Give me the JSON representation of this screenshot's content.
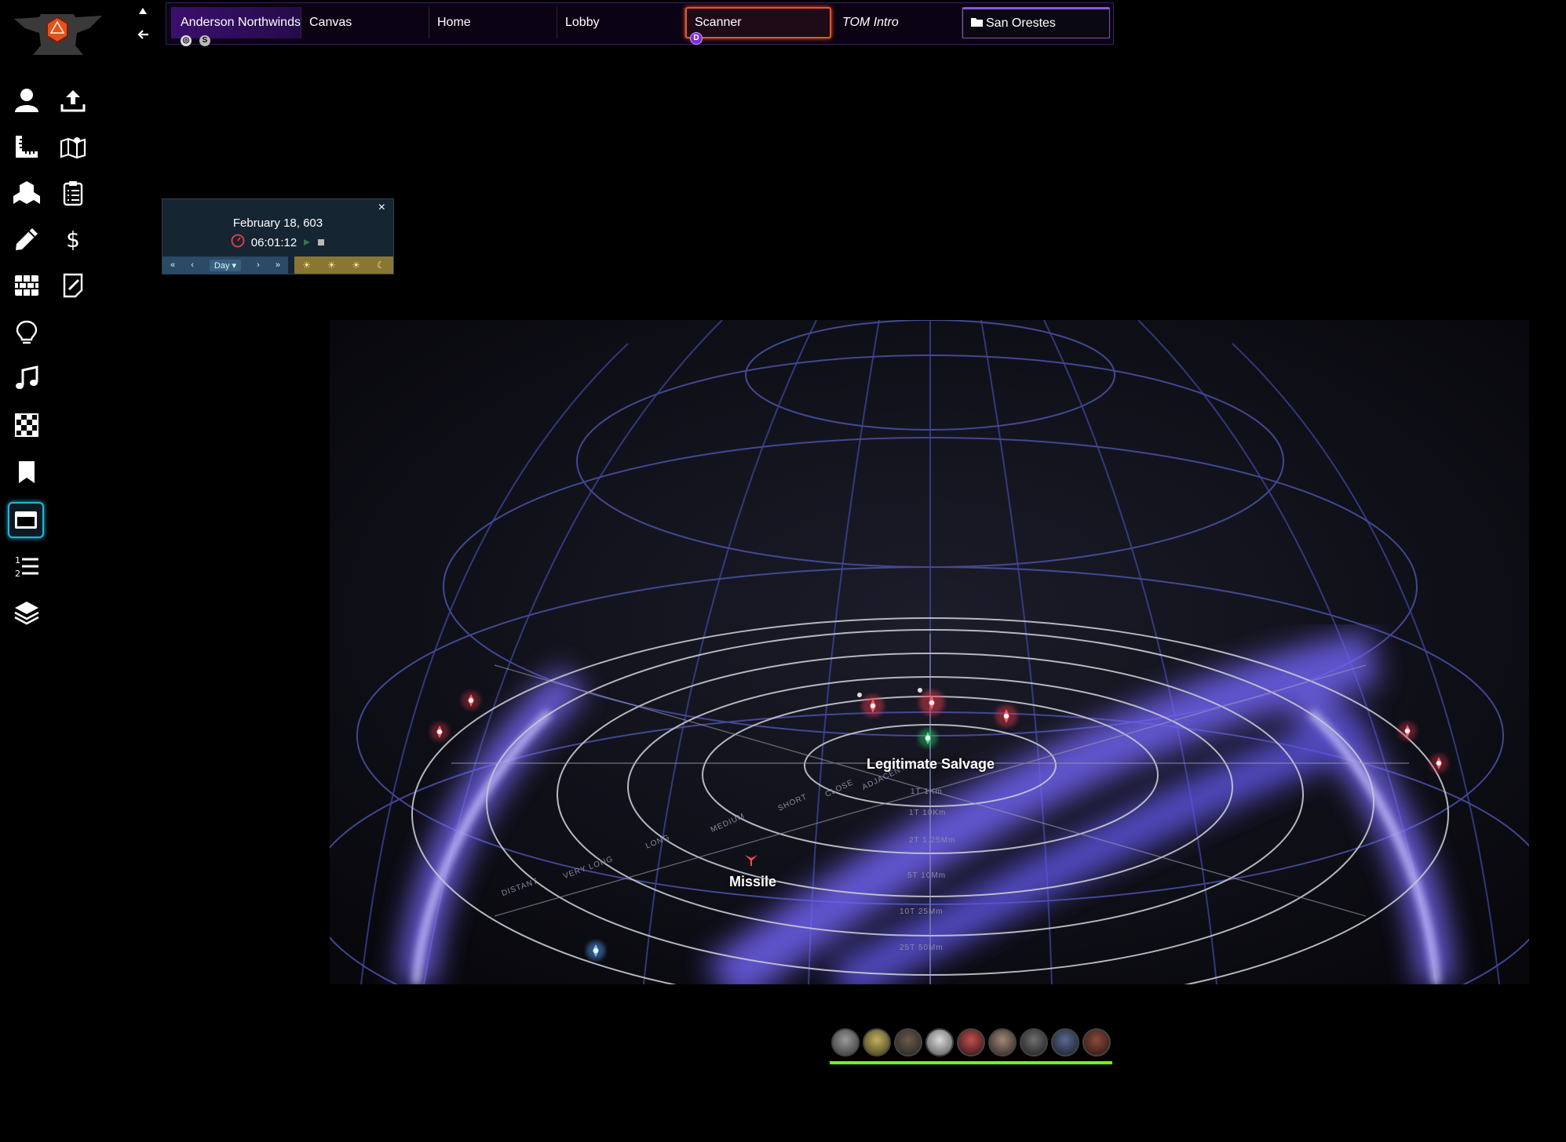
{
  "app": {
    "navigation": {
      "up_icon": "triangle-up-icon",
      "back_icon": "arrow-left-icon"
    },
    "sidebar": {
      "tools": [
        {
          "name": "character",
          "icon": "person-icon"
        },
        {
          "name": "upload",
          "icon": "upload-icon"
        },
        {
          "name": "measure",
          "icon": "ruler-icon"
        },
        {
          "name": "maps",
          "icon": "map-icon"
        },
        {
          "name": "items",
          "icon": "cubes-icon"
        },
        {
          "name": "journal",
          "icon": "clipboard-icon"
        },
        {
          "name": "draw",
          "icon": "pencil-icon"
        },
        {
          "name": "currency",
          "icon": "dollar-icon"
        },
        {
          "name": "walls",
          "icon": "bricks-icon"
        },
        {
          "name": "notes",
          "icon": "note-edit-icon"
        },
        {
          "name": "lighting",
          "icon": "lightbulb-icon"
        },
        {
          "name": "sound",
          "icon": "music-icon"
        },
        {
          "name": "tiles",
          "icon": "checkerboard-icon"
        },
        {
          "name": "bookmarks",
          "icon": "bookmark-icon"
        },
        {
          "name": "windows",
          "icon": "window-icon",
          "active": true
        },
        {
          "name": "list",
          "icon": "numbered-list-icon"
        },
        {
          "name": "layers",
          "icon": "layers-icon"
        }
      ]
    },
    "scene_tabs": [
      {
        "label": "Anderson Northwinds",
        "badges": [
          "◎",
          "S"
        ]
      },
      {
        "label": "Canvas"
      },
      {
        "label": "Home"
      },
      {
        "label": "Lobby"
      },
      {
        "label": "Scanner",
        "badge": "D",
        "active": true
      },
      {
        "label": "TOM Intro",
        "italic": true
      },
      {
        "label": "San Orestes",
        "folder": true
      }
    ],
    "calendar": {
      "close": "×",
      "date": "February 18, 603",
      "time": "06:01:12",
      "nav": [
        "«",
        "‹",
        "Day ▾",
        "›",
        "»"
      ],
      "phases": [
        "☀",
        "☀",
        "☀",
        "☾"
      ]
    },
    "scene": {
      "labels": {
        "salvage": "Legitimate Salvage",
        "missile": "Missile"
      },
      "range_bands": [
        "DISTANT",
        "VERY LONG",
        "LONG",
        "MEDIUM",
        "SHORT",
        "CLOSE",
        "ADJACENT"
      ],
      "ring_ranges": [
        "1T 1Km",
        "1T 10Km",
        "2T 1.25Mm",
        "5T 10Mm",
        "10T 25Mm",
        "25T 50Mm"
      ]
    },
    "players": {
      "count": 9,
      "hp_color": "#6cff1a"
    },
    "colors": {
      "accent": "#8a55e0",
      "scanner_border": "#e5542a",
      "hostile": "#e33a4a",
      "friendly": "#2ee06a",
      "ally_blue": "#5aa8ff"
    }
  }
}
